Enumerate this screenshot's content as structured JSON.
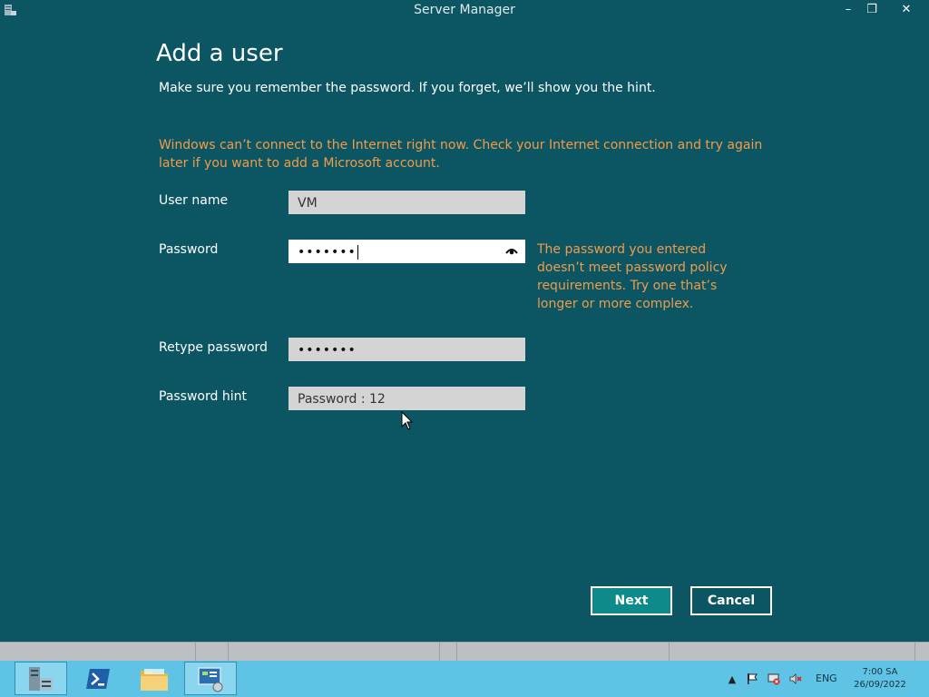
{
  "window": {
    "title": "Server Manager",
    "minimize_glyph": "–",
    "restore_glyph": "❐",
    "close_glyph": "✕"
  },
  "dialog": {
    "heading": "Add a user",
    "subtitle": "Make sure you remember the password. If you forget, we’ll show you the hint.",
    "warning": "Windows can’t connect to the Internet right now. Check your Internet connection and try again later if you want to add a Microsoft account.",
    "fields": {
      "username": {
        "label": "User name",
        "value": "VM"
      },
      "password": {
        "label": "Password",
        "value": "•••••••"
      },
      "retype": {
        "label": "Retype password",
        "value": "•••••••"
      },
      "hint": {
        "label": "Password hint",
        "value": "Password : 12"
      }
    },
    "password_error": "The password you entered doesn’t meet password policy requirements. Try one that’s longer or more complex.",
    "buttons": {
      "next": "Next",
      "cancel": "Cancel"
    }
  },
  "taskbar": {
    "items": [
      "server-manager",
      "powershell",
      "file-explorer",
      "control-panel"
    ],
    "language": "ENG",
    "time": "7:00 SA",
    "date": "26/09/2022",
    "colors": {
      "bar": "#5ec3e4",
      "accent": "#0c5664",
      "warning": "#f19b4a"
    }
  }
}
